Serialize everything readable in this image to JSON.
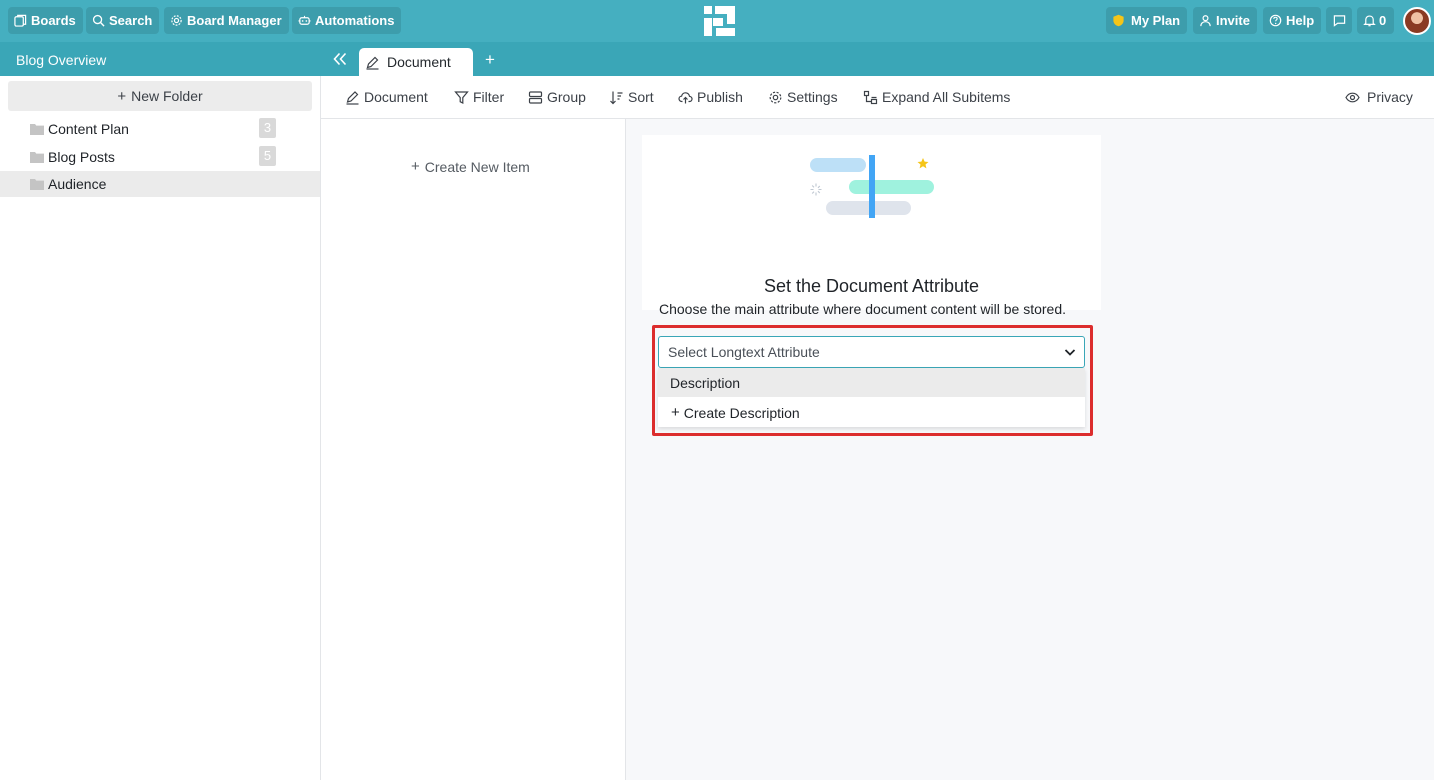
{
  "topbar": {
    "boards": "Boards",
    "search": "Search",
    "board_manager": "Board Manager",
    "automations": "Automations",
    "my_plan": "My Plan",
    "invite": "Invite",
    "help": "Help",
    "notifications_count": "0"
  },
  "subbar": {
    "board_title": "Blog Overview",
    "tab_label": "Document",
    "add_tab": "+"
  },
  "sidebar": {
    "new_folder": "New Folder",
    "folders": [
      {
        "name": "Content Plan",
        "count": "3"
      },
      {
        "name": "Blog Posts",
        "count": "5"
      },
      {
        "name": "Audience",
        "count": ""
      }
    ]
  },
  "toolbar": {
    "document": "Document",
    "filter": "Filter",
    "group": "Group",
    "sort": "Sort",
    "publish": "Publish",
    "settings": "Settings",
    "expand": "Expand All Subitems",
    "privacy": "Privacy"
  },
  "items": {
    "create_new": "Create New Item"
  },
  "main": {
    "title": "Set the Document Attribute",
    "description": "Choose the main attribute where document content will be stored.",
    "select_placeholder": "Select Longtext Attribute",
    "options": [
      "Description"
    ],
    "create_option": "Create Description"
  },
  "colors": {
    "topbar": "#45afc0",
    "subbar": "#3aa6b7",
    "highlight_border": "#dc2d2d",
    "plan_icon": "#f5c518"
  }
}
